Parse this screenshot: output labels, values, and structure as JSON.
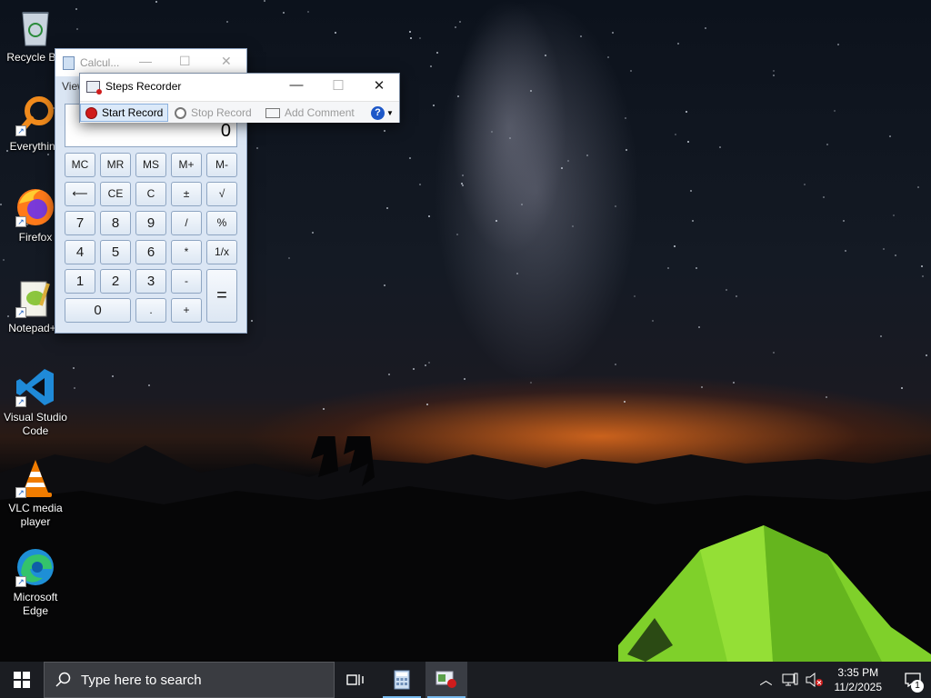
{
  "desktop": {
    "icons": [
      {
        "label": "Recycle Bin",
        "icon": "recycle-bin-icon"
      },
      {
        "label": "Everything",
        "icon": "everything-search-icon"
      },
      {
        "label": "Firefox",
        "icon": "firefox-icon"
      },
      {
        "label": "Notepad++",
        "icon": "notepad-plus-plus-icon"
      },
      {
        "label": "Visual Studio Code",
        "icon": "vscode-icon"
      },
      {
        "label": "VLC media player",
        "icon": "vlc-icon"
      },
      {
        "label": "Microsoft Edge",
        "icon": "edge-icon"
      }
    ]
  },
  "calculator": {
    "title": "Calcul...",
    "menu_view": "View",
    "display_value": "0",
    "buttons": [
      [
        "MC",
        "MR",
        "MS",
        "M+",
        "M-"
      ],
      [
        "⟵",
        "CE",
        "C",
        "±",
        "√"
      ],
      [
        "7",
        "8",
        "9",
        "/",
        "%"
      ],
      [
        "4",
        "5",
        "6",
        "*",
        "1/x"
      ],
      [
        "1",
        "2",
        "3",
        "-",
        "="
      ],
      [
        "0",
        ".",
        "+"
      ]
    ]
  },
  "steps_recorder": {
    "title": "Steps Recorder",
    "start_record": "Start Record",
    "stop_record": "Stop Record",
    "add_comment": "Add Comment",
    "help_glyph": "?"
  },
  "taskbar": {
    "search_placeholder": "Type here to search",
    "time": "3:35 PM",
    "date": "11/2/2025",
    "notification_count": "1"
  },
  "colors": {
    "record_red": "#d01c1c",
    "tent_green": "#7fd02a",
    "taskbar_bg": "#1b1d22",
    "accent_blue": "#76b9ed"
  }
}
